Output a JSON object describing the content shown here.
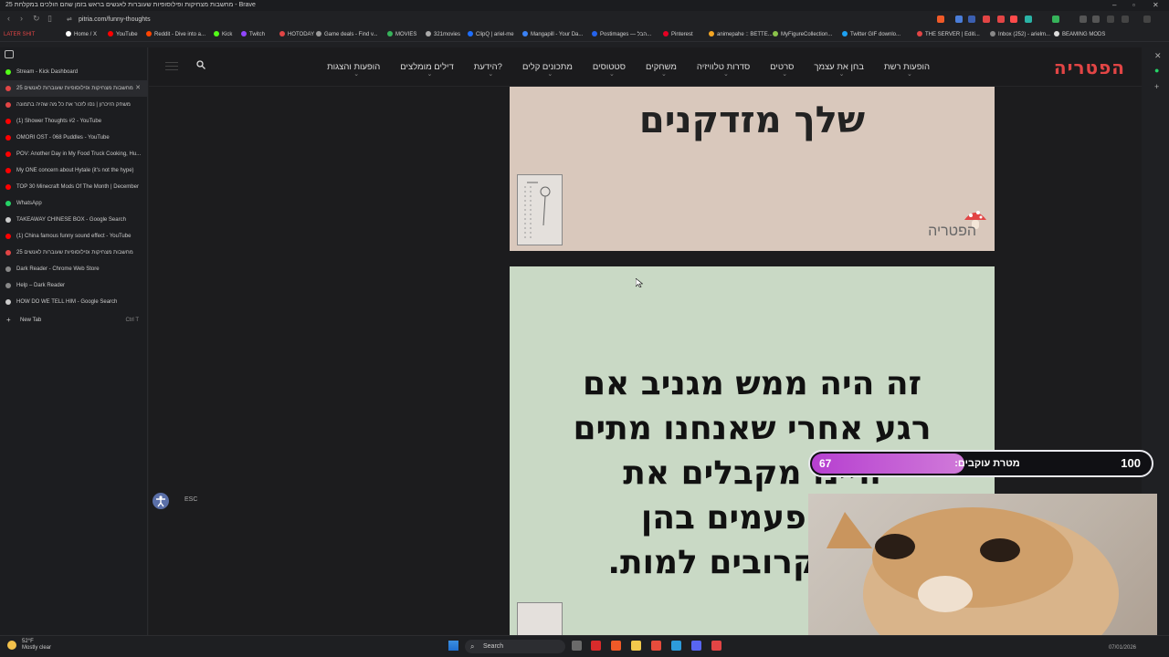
{
  "window": {
    "title": "25 מחשבות מצחיקות ופילוסופיות שעוברות לאנשים בראש בזמן שהם הולכים במקלחת - Brave"
  },
  "address": {
    "url": "pitria.com/funny-thoughts"
  },
  "bookmarks": [
    "LATER SHIT",
    "Home / X",
    "YouTube",
    "Reddit - Dive into a...",
    "Kick",
    "Twitch",
    "HOTODAY",
    "Game deals - Find v...",
    "MOVIES",
    "321movies",
    "ClipQ | ariel-me",
    "Mangapill - Your Da...",
    "Postimages — הבל...",
    "Pinterest",
    "animepahe :: BETTE...",
    "MyFigureCollection...",
    "Twitter GIF downlo...",
    "THE SERVER | Editi...",
    "Inbox (252) - arielm...",
    "BEAMING MODS"
  ],
  "tabs": [
    {
      "label": "Stream - Kick Dashboard",
      "color": "#53fc18"
    },
    {
      "label": "25 מחשבות מצחיקות ופילוסופיות שעוברות לאנשים",
      "color": "#e24545",
      "active": true
    },
    {
      "label": "משחק הזיכרון | נסו לזכור את כל מה שהיה בתמונה",
      "color": "#e24545"
    },
    {
      "label": "(1) Shower Thoughts #2 - YouTube",
      "color": "#ff0000"
    },
    {
      "label": "OMORI OST - 068 Puddles - YouTube",
      "color": "#ff0000"
    },
    {
      "label": "POV: Another Day in My Food Truck Cooking, Hu...",
      "color": "#ff0000"
    },
    {
      "label": "My ONE concern about Hytale (it's not the hype)",
      "color": "#ff0000"
    },
    {
      "label": "TOP 30 Minecraft Mods Of The Month | December",
      "color": "#ff0000"
    },
    {
      "label": "WhatsApp",
      "color": "#25d366"
    },
    {
      "label": "TAKEAWAY CHINESE BOX - Google Search",
      "color": "#cccccc"
    },
    {
      "label": "(1) China famous funny sound effect - YouTube",
      "color": "#ff0000"
    },
    {
      "label": "25 מחשבות מצחיקות ופילוסופיות שעוברות לאנשים",
      "color": "#e24545"
    },
    {
      "label": "Dark Reader - Chrome Web Store",
      "color": "#888888"
    },
    {
      "label": "Help – Dark Reader",
      "color": "#888888"
    },
    {
      "label": "HOW DO WE TELL HIM - Google Search",
      "color": "#cccccc"
    }
  ],
  "new_tab": {
    "label": "New Tab",
    "shortcut": "Ctrl T"
  },
  "site": {
    "logo": "הפטריה",
    "nav": [
      "הופעות רשת",
      "בחן את עצמך",
      "סרטים",
      "סדרות טלוויזיה",
      "משחקים",
      "סטטוסים",
      "מתכונים קלים",
      "הידעת?",
      "דילים מומלצים",
      "הופעות והצגות"
    ]
  },
  "card1": {
    "text": "שלך מזדקנים",
    "brand": "הפטריה"
  },
  "card2": {
    "lines": [
      "זה היה ממש מגניב אם",
      "רגע אחרי שאנחנו מתים",
      "היינו מקבלים את",
      "5 הפעמים בהן",
      "היינו קרובים למות."
    ]
  },
  "access": {
    "esc_label": "ESC"
  },
  "overlay": {
    "current": "67",
    "goal_label": "מטרת עוקבים:",
    "max": "100",
    "progress": 0.67
  },
  "taskbar": {
    "temp": "52°F",
    "condition": "Mostly clear",
    "search_placeholder": "Search",
    "date": "07/01/2026"
  },
  "colors": {
    "brand_red": "#e24545",
    "progress_purple": "#b63fd0"
  }
}
